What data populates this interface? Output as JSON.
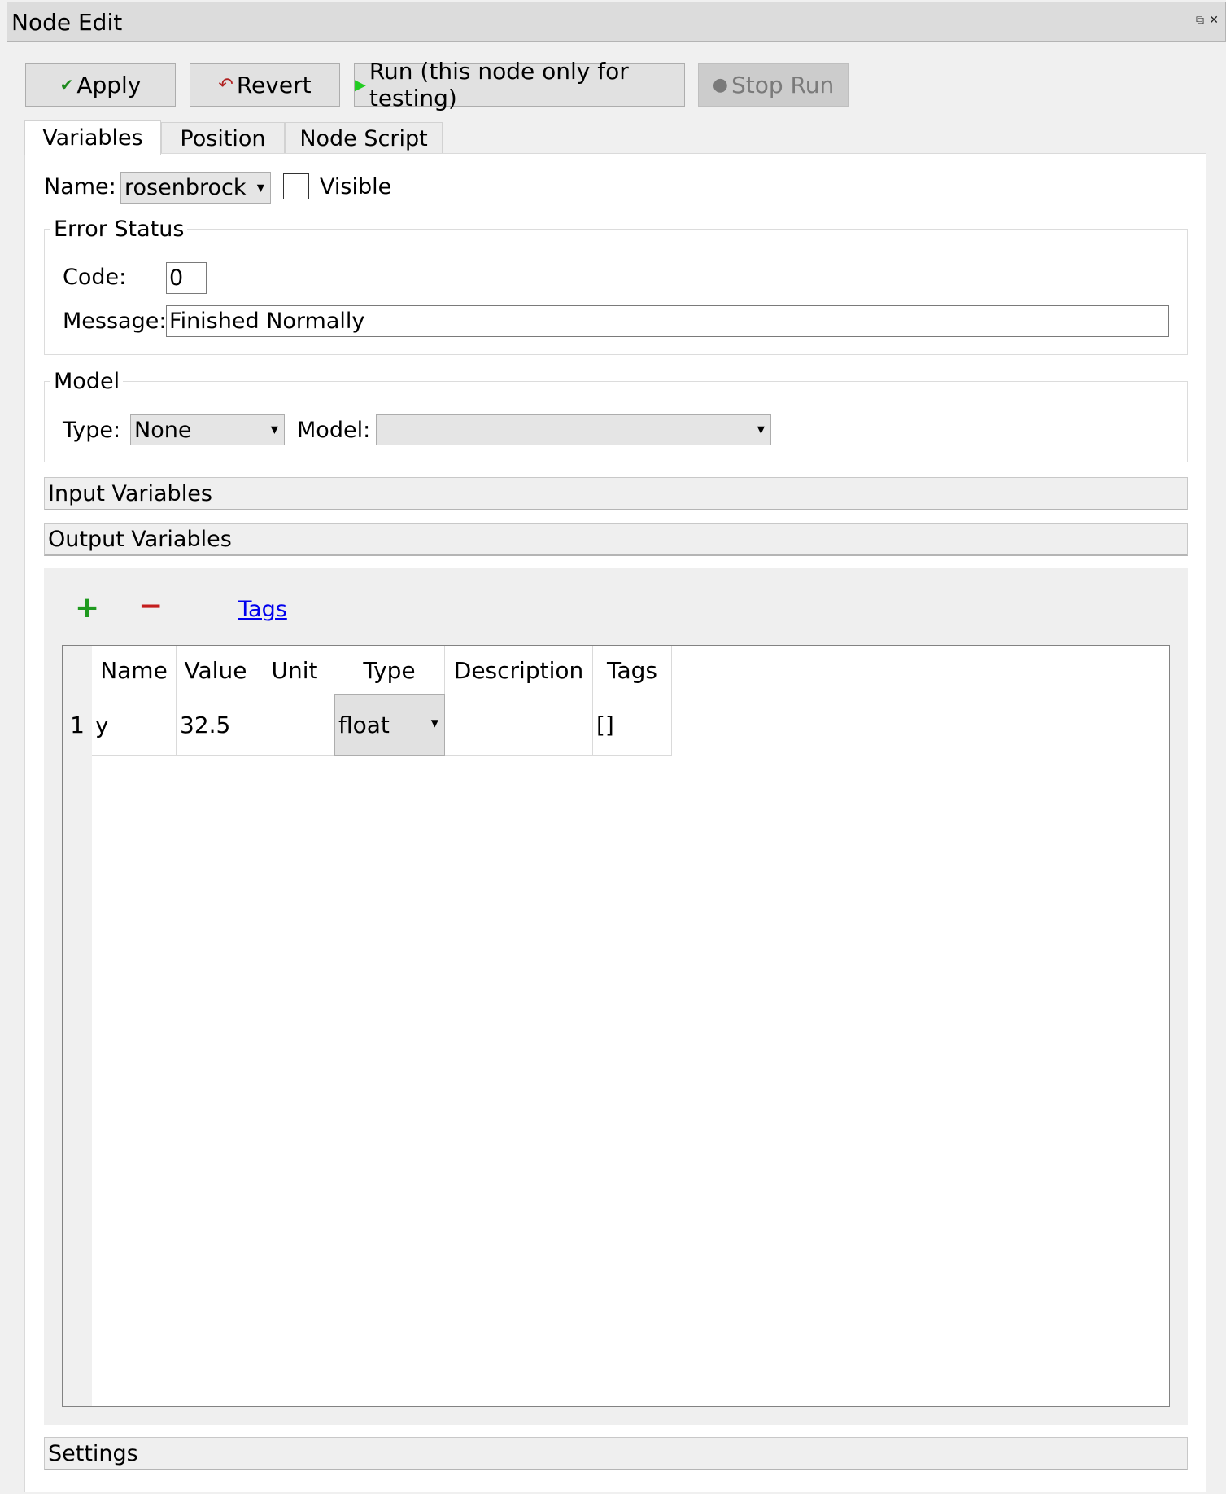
{
  "window": {
    "title": "Node Edit",
    "restore_icon": "restore-icon",
    "close_icon": "close-icon"
  },
  "toolbar": {
    "apply_label": "Apply",
    "revert_label": "Revert",
    "run_label": "Run (this node only for testing)",
    "stop_label": "Stop Run"
  },
  "tabs": [
    {
      "label": "Variables",
      "active": true
    },
    {
      "label": "Position",
      "active": false
    },
    {
      "label": "Node Script",
      "active": false
    }
  ],
  "node": {
    "name_label": "Name:",
    "name_value": "rosenbrock",
    "visible_label": "Visible",
    "visible_checked": false
  },
  "error_status": {
    "title": "Error Status",
    "code_label": "Code:",
    "code_value": "0",
    "message_label": "Message:",
    "message_value": "Finished Normally"
  },
  "model": {
    "title": "Model",
    "type_label": "Type:",
    "type_value": "None",
    "model_label": "Model:",
    "model_value": ""
  },
  "sections": {
    "input_variables": "Input Variables",
    "output_variables": "Output Variables",
    "settings": "Settings"
  },
  "output_toolbar": {
    "add_icon": "plus-icon",
    "remove_icon": "minus-icon",
    "tags_link": "Tags"
  },
  "output_table": {
    "columns": [
      "Name",
      "Value",
      "Unit",
      "Type",
      "Description",
      "Tags"
    ],
    "rows": [
      {
        "index": "1",
        "name": "y",
        "value": "32.5",
        "unit": "",
        "type": "float",
        "description": "",
        "tags": "[]"
      }
    ]
  },
  "colors": {
    "accent_green": "#22cc22",
    "add_green": "#1f9a1f",
    "remove_red": "#c41e1e",
    "link_blue": "#0000ee"
  }
}
